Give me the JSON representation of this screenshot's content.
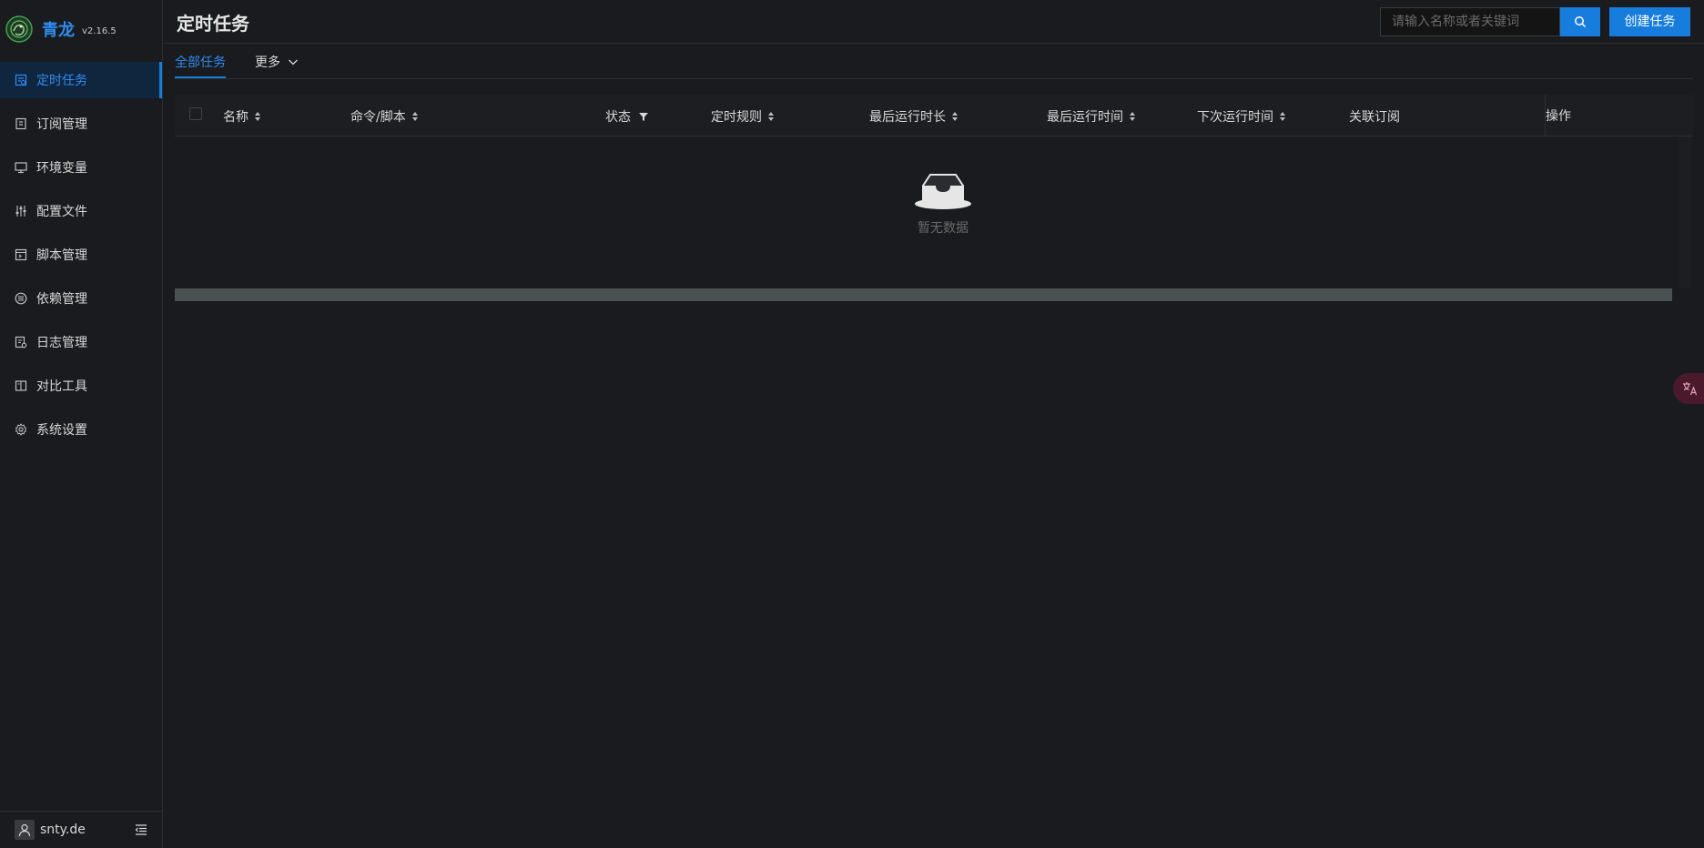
{
  "app": {
    "name": "青龙",
    "version": "v2.16.5"
  },
  "sidebar": {
    "items": [
      {
        "label": "定时任务",
        "icon": "schedule-icon",
        "active": true
      },
      {
        "label": "订阅管理",
        "icon": "subscription-icon"
      },
      {
        "label": "环境变量",
        "icon": "monitor-icon"
      },
      {
        "label": "配置文件",
        "icon": "sliders-icon"
      },
      {
        "label": "脚本管理",
        "icon": "script-icon"
      },
      {
        "label": "依赖管理",
        "icon": "dependency-icon"
      },
      {
        "label": "日志管理",
        "icon": "log-icon"
      },
      {
        "label": "对比工具",
        "icon": "diff-icon"
      },
      {
        "label": "系统设置",
        "icon": "gear-icon"
      }
    ],
    "footer": {
      "username": "snty.de"
    }
  },
  "header": {
    "title": "定时任务",
    "search_placeholder": "请输入名称或者关键词",
    "create_label": "创建任务"
  },
  "tabs": {
    "all": "全部任务",
    "more": "更多"
  },
  "table": {
    "columns": {
      "name": "名称",
      "command": "命令/脚本",
      "status": "状态",
      "schedule": "定时规则",
      "last_duration": "最后运行时长",
      "last_run": "最后运行时间",
      "next_run": "下次运行时间",
      "subscription": "关联订阅",
      "action": "操作"
    },
    "empty_text": "暂无数据"
  },
  "colors": {
    "accent": "#177ddc",
    "active_text": "#2f8cf0",
    "background": "#1a1b1e"
  }
}
